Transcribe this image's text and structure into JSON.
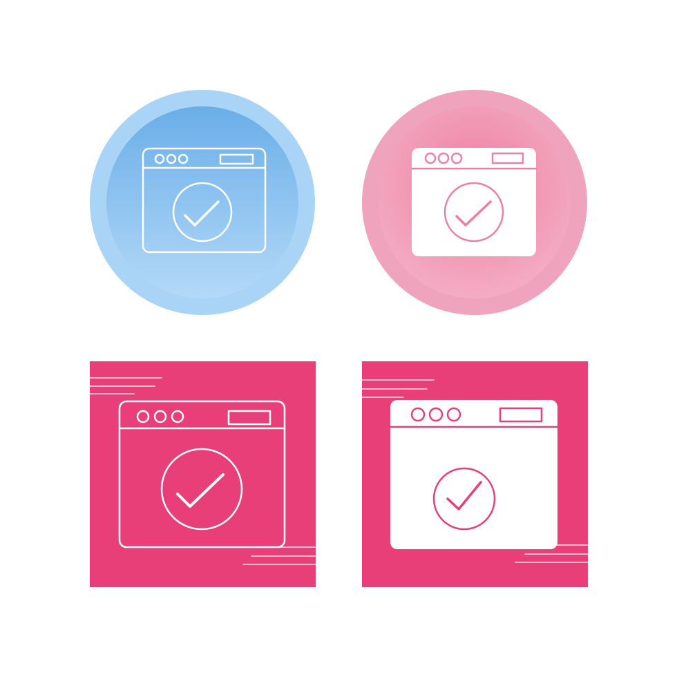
{
  "icon_set": {
    "subject": "browser-window-check-icon",
    "variants": [
      {
        "style": "line",
        "shape": "circle",
        "colors": {
          "outer": "#a9d4f6",
          "inner_top": "#6aaee8",
          "inner_bottom": "#b4d9f8",
          "icon": "#ffffff"
        }
      },
      {
        "style": "glyph",
        "shape": "circle",
        "colors": {
          "outer": "#f0a3bc",
          "inner_top": "#ee7fa3",
          "inner_bottom": "#f4b0c6",
          "icon": "#ffffff",
          "detail": "#ee7fa3"
        }
      },
      {
        "style": "line",
        "shape": "square",
        "colors": {
          "background": "#e83f78",
          "icon": "#ffffff",
          "speed_lines": "#ffffff"
        }
      },
      {
        "style": "glyph",
        "shape": "square",
        "colors": {
          "background": "#e83f78",
          "icon": "#ffffff",
          "detail": "#e83f78",
          "speed_lines": "#ffffff"
        }
      }
    ]
  }
}
